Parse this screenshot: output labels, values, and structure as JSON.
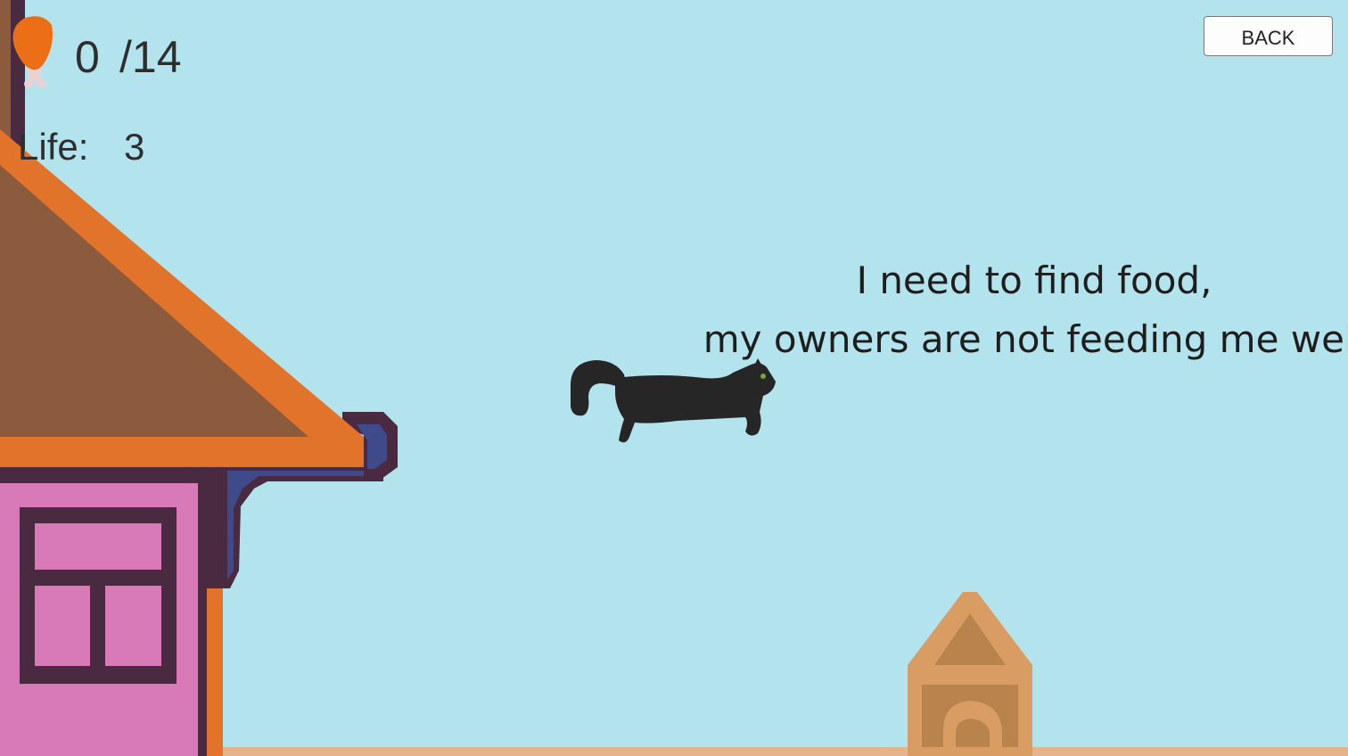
{
  "hud": {
    "food_icon": "chicken-drumstick-icon",
    "food_collected": "0",
    "food_total": "/14",
    "life_label": "Life:",
    "life_value": "3"
  },
  "buttons": {
    "back_label": "BACK"
  },
  "dialog": {
    "line1": "I need to find food,",
    "line2": "my owners are not feeding me well"
  },
  "colors": {
    "sky": "#b3e4ee",
    "ground": "#e6b48a",
    "roof_edge": "#e2732a",
    "roof_fill": "#8c5a3c",
    "house_wall": "#d87ab8",
    "house_trim": "#4a2a40",
    "gutter": "#3e4a8a",
    "doghouse": "#d99d63",
    "doghouse_dark": "#b9834d",
    "cat": "#262626"
  }
}
